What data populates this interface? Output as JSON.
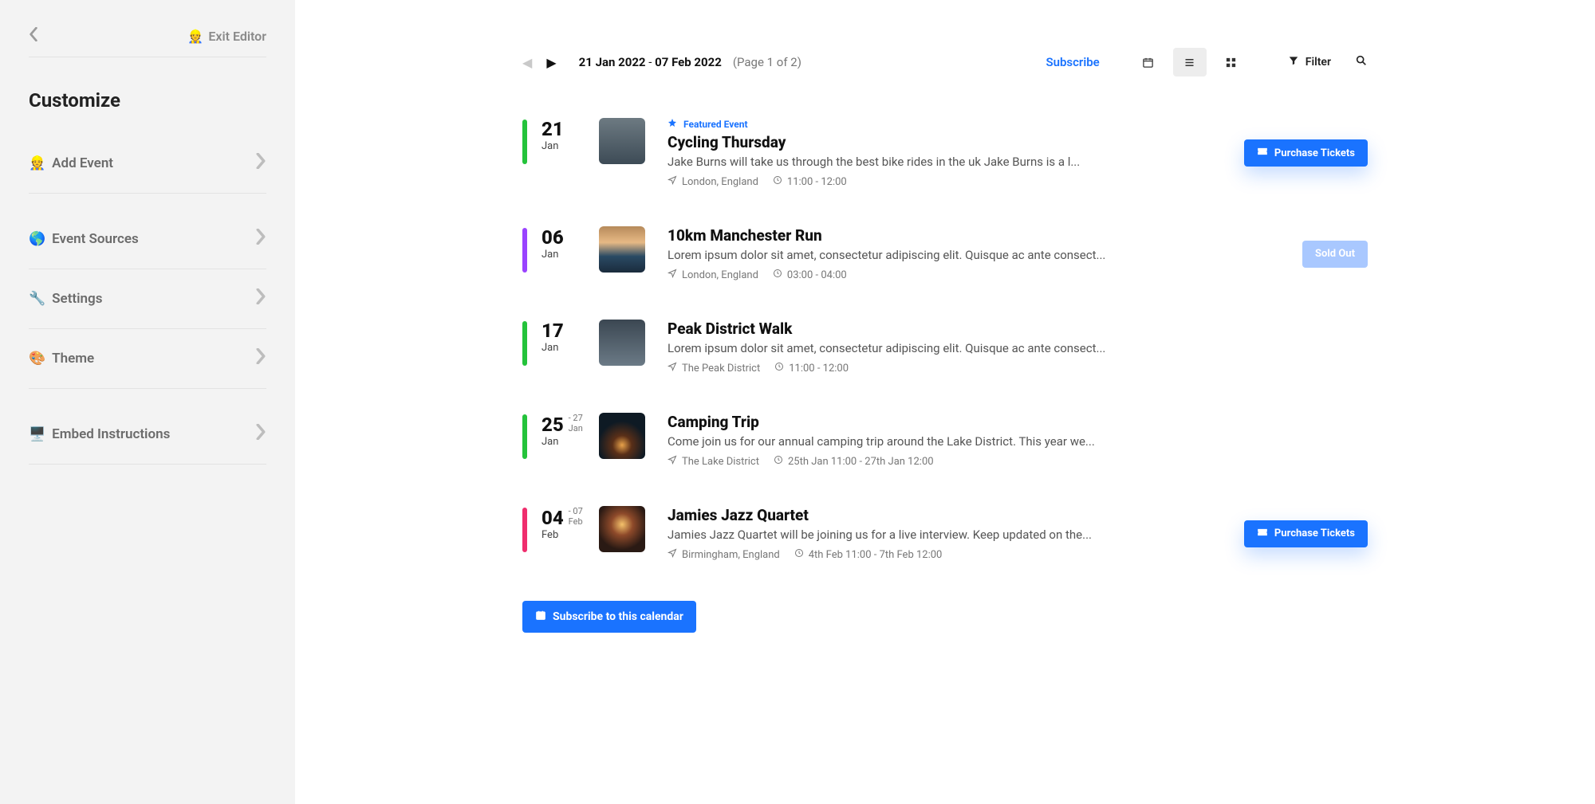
{
  "sidebar": {
    "exit_label": "Exit Editor",
    "exit_icon": "👷",
    "heading": "Customize",
    "items": [
      {
        "id": "add-event",
        "icon": "👷",
        "label": "Add Event"
      },
      {
        "id": "event-sources",
        "icon": "🌎",
        "label": "Event Sources"
      },
      {
        "id": "settings",
        "icon": "🔧",
        "label": "Settings"
      },
      {
        "id": "theme",
        "icon": "🎨",
        "label": "Theme"
      },
      {
        "id": "embed",
        "icon": "🖥️",
        "label": "Embed Instructions"
      }
    ]
  },
  "toolbar": {
    "range_start": "21 Jan 2022",
    "range_end": "07 Feb 2022",
    "page_indicator": "(Page 1 of 2)",
    "subscribe_label": "Subscribe",
    "filter_label": "Filter"
  },
  "events": [
    {
      "stripe_color": "#24c33b",
      "day": "21",
      "month": "Jan",
      "day_end": "",
      "month_end": "",
      "thumb_class": "t1",
      "featured": true,
      "featured_label": "Featured Event",
      "title": "Cycling Thursday",
      "desc": "Jake Burns will take us through the best bike rides in the uk Jake Burns is a l...",
      "location": "London, England",
      "time": "11:00 - 12:00",
      "cta": {
        "type": "purchase",
        "label": "Purchase Tickets"
      }
    },
    {
      "stripe_color": "#9a43ff",
      "day": "06",
      "month": "Jan",
      "day_end": "",
      "month_end": "",
      "thumb_class": "t2",
      "featured": false,
      "title": "10km Manchester Run",
      "desc": "Lorem ipsum dolor sit amet, consectetur adipiscing elit. Quisque ac ante consect...",
      "location": "London, England",
      "time": "03:00 - 04:00",
      "cta": {
        "type": "sold",
        "label": "Sold Out"
      }
    },
    {
      "stripe_color": "#24c33b",
      "day": "17",
      "month": "Jan",
      "day_end": "",
      "month_end": "",
      "thumb_class": "t3",
      "featured": false,
      "title": "Peak District Walk",
      "desc": "Lorem ipsum dolor sit amet, consectetur adipiscing elit. Quisque ac ante consect...",
      "location": "The Peak District",
      "time": "11:00 - 12:00",
      "cta": null
    },
    {
      "stripe_color": "#24c33b",
      "day": "25",
      "month": "Jan",
      "day_end": "27",
      "month_end": "Jan",
      "thumb_class": "t4",
      "featured": false,
      "title": "Camping Trip",
      "desc": "Come join us for our annual camping trip around the Lake District. This year we...",
      "location": "The Lake District",
      "time": "25th Jan 11:00 - 27th Jan 12:00",
      "cta": null
    },
    {
      "stripe_color": "#ef2d6d",
      "day": "04",
      "month": "Feb",
      "day_end": "07",
      "month_end": "Feb",
      "thumb_class": "t5",
      "featured": false,
      "title": "Jamies Jazz Quartet",
      "desc": "Jamies Jazz Quartet will be joining us for a live interview. Keep updated on the...",
      "location": "Birmingham, England",
      "time": "4th Feb 11:00 - 7th Feb 12:00",
      "cta": {
        "type": "purchase",
        "label": "Purchase Tickets"
      }
    }
  ],
  "footer": {
    "subscribe_btn": "Subscribe to this calendar"
  }
}
